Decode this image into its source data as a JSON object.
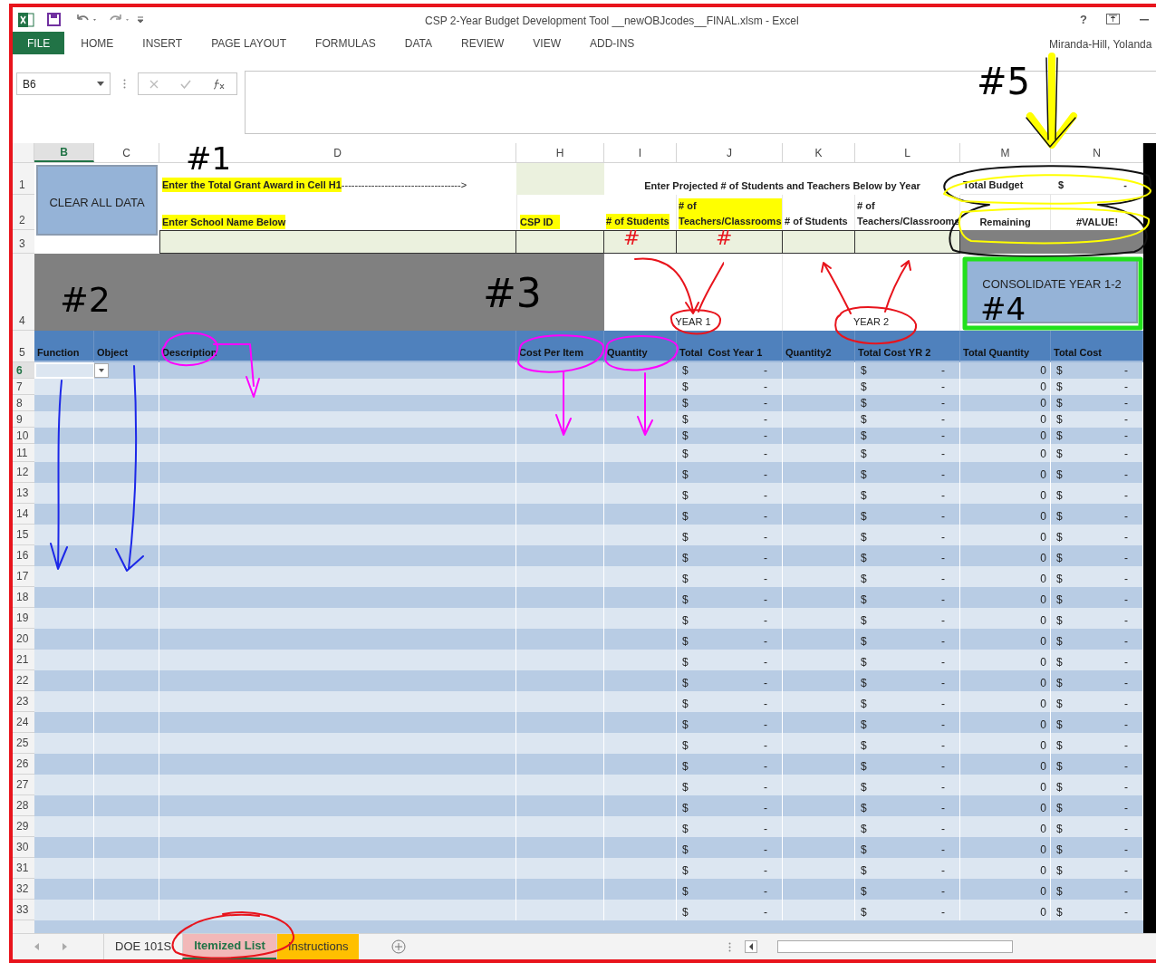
{
  "window": {
    "title": "CSP 2-Year Budget Development Tool __newOBJcodes__FINAL.xlsm - Excel",
    "help": "?",
    "user": "Miranda-Hill, Yolanda"
  },
  "ribbon_tabs": [
    {
      "label": "FILE",
      "selected": true
    },
    {
      "label": "HOME",
      "selected": false
    },
    {
      "label": "INSERT",
      "selected": false
    },
    {
      "label": "PAGE LAYOUT",
      "selected": false
    },
    {
      "label": "FORMULAS",
      "selected": false
    },
    {
      "label": "DATA",
      "selected": false
    },
    {
      "label": "REVIEW",
      "selected": false
    },
    {
      "label": "VIEW",
      "selected": false
    },
    {
      "label": "ADD-INS",
      "selected": false
    }
  ],
  "name_box": "B6",
  "column_headers": [
    {
      "label": "B",
      "selected": true
    },
    {
      "label": "C",
      "selected": false
    },
    {
      "label": "D",
      "selected": false
    },
    {
      "label": "H",
      "selected": false
    },
    {
      "label": "I",
      "selected": false
    },
    {
      "label": "J",
      "selected": false
    },
    {
      "label": "K",
      "selected": false
    },
    {
      "label": "L",
      "selected": false
    },
    {
      "label": "M",
      "selected": false
    },
    {
      "label": "N",
      "selected": false
    }
  ],
  "header_row_numbers": [
    "1",
    "2",
    "3",
    "4",
    "5"
  ],
  "clear_button": "CLEAR ALL DATA",
  "grant_instruction": "Enter the Total Grant Award in Cell H1",
  "grant_arrow": "------------------------------------>",
  "enrollment_heading": "Enter Projected # of Students and Teachers Below by Year",
  "total_budget": {
    "label": "Total Budget",
    "currency": "$",
    "amount": "-"
  },
  "school_label": "Enter School Name Below",
  "csp_label": "CSP ID",
  "enrollment_labels": [
    "# of Students",
    "# of Teachers/Classrooms",
    "# of Students",
    "# of Teachers/Classrooms"
  ],
  "remaining": {
    "label": "Remaining",
    "value": "#VALUE!"
  },
  "year_labels": [
    "YEAR 1",
    "YEAR 2"
  ],
  "consolidate_button": "CONSOLIDATE YEAR 1-2",
  "table_headers": [
    "Function",
    "Object",
    "Description",
    "Cost Per Item",
    "Quantity",
    "Total  Cost Year 1",
    "Quantity2",
    "Total Cost YR 2",
    "Total Quantity",
    "Total Cost"
  ],
  "rows": [
    {
      "number": "6",
      "selected": true,
      "currency": "$",
      "amount": "-",
      "total_quantity": "0"
    },
    {
      "number": "7",
      "selected": false,
      "currency": "$",
      "amount": "-",
      "total_quantity": "0"
    },
    {
      "number": "8",
      "selected": false,
      "currency": "$",
      "amount": "-",
      "total_quantity": "0"
    },
    {
      "number": "9",
      "selected": false,
      "currency": "$",
      "amount": "-",
      "total_quantity": "0"
    },
    {
      "number": "10",
      "selected": false,
      "currency": "$",
      "amount": "-",
      "total_quantity": "0"
    },
    {
      "number": "11",
      "selected": false,
      "currency": "$",
      "amount": "-",
      "total_quantity": "0"
    },
    {
      "number": "12",
      "selected": false,
      "currency": "$",
      "amount": "-",
      "total_quantity": "0"
    },
    {
      "number": "13",
      "selected": false,
      "currency": "$",
      "amount": "-",
      "total_quantity": "0"
    },
    {
      "number": "14",
      "selected": false,
      "currency": "$",
      "amount": "-",
      "total_quantity": "0"
    },
    {
      "number": "15",
      "selected": false,
      "currency": "$",
      "amount": "-",
      "total_quantity": "0"
    },
    {
      "number": "16",
      "selected": false,
      "currency": "$",
      "amount": "-",
      "total_quantity": "0"
    },
    {
      "number": "17",
      "selected": false,
      "currency": "$",
      "amount": "-",
      "total_quantity": "0"
    },
    {
      "number": "18",
      "selected": false,
      "currency": "$",
      "amount": "-",
      "total_quantity": "0"
    },
    {
      "number": "19",
      "selected": false,
      "currency": "$",
      "amount": "-",
      "total_quantity": "0"
    },
    {
      "number": "20",
      "selected": false,
      "currency": "$",
      "amount": "-",
      "total_quantity": "0"
    },
    {
      "number": "21",
      "selected": false,
      "currency": "$",
      "amount": "-",
      "total_quantity": "0"
    },
    {
      "number": "22",
      "selected": false,
      "currency": "$",
      "amount": "-",
      "total_quantity": "0"
    },
    {
      "number": "23",
      "selected": false,
      "currency": "$",
      "amount": "-",
      "total_quantity": "0"
    },
    {
      "number": "24",
      "selected": false,
      "currency": "$",
      "amount": "-",
      "total_quantity": "0"
    },
    {
      "number": "25",
      "selected": false,
      "currency": "$",
      "amount": "-",
      "total_quantity": "0"
    },
    {
      "number": "26",
      "selected": false,
      "currency": "$",
      "amount": "-",
      "total_quantity": "0"
    },
    {
      "number": "27",
      "selected": false,
      "currency": "$",
      "amount": "-",
      "total_quantity": "0"
    },
    {
      "number": "28",
      "selected": false,
      "currency": "$",
      "amount": "-",
      "total_quantity": "0"
    },
    {
      "number": "29",
      "selected": false,
      "currency": "$",
      "amount": "-",
      "total_quantity": "0"
    },
    {
      "number": "30",
      "selected": false,
      "currency": "$",
      "amount": "-",
      "total_quantity": "0"
    },
    {
      "number": "31",
      "selected": false,
      "currency": "$",
      "amount": "-",
      "total_quantity": "0"
    },
    {
      "number": "32",
      "selected": false,
      "currency": "$",
      "amount": "-",
      "total_quantity": "0"
    },
    {
      "number": "33",
      "selected": false,
      "currency": "$",
      "amount": "-",
      "total_quantity": "0"
    }
  ],
  "sheet_tabs": [
    {
      "label": "DOE 101S",
      "selected": false
    },
    {
      "label": "Itemized List",
      "selected": true,
      "color": "#f2b8b8"
    },
    {
      "label": "Instructions",
      "selected": false,
      "color": "#ffc000"
    }
  ],
  "annotations": [
    "#1",
    "#2",
    "#3",
    "#4",
    "#5"
  ],
  "cell_marks": [
    "#",
    "#"
  ]
}
